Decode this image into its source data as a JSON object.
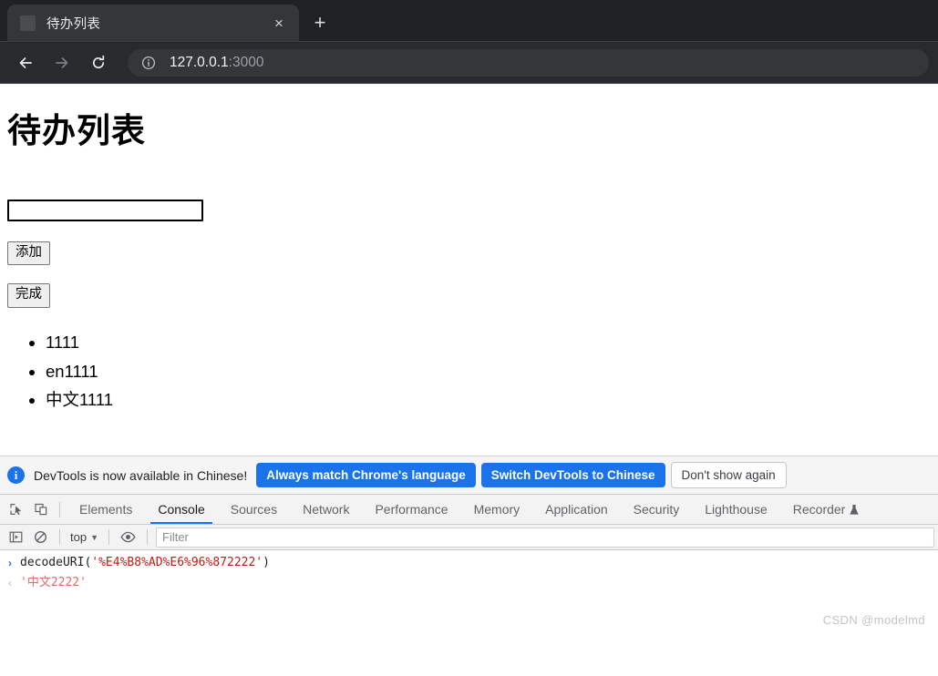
{
  "browser": {
    "tab": {
      "title": "待办列表",
      "favicon": "page-favicon",
      "close_label": "×"
    },
    "new_tab_label": "+",
    "nav": {
      "back": "back-arrow",
      "forward": "forward-arrow",
      "reload": "reload"
    },
    "omnibox": {
      "security_icon": "info-circle-icon",
      "host": "127.0.0.1",
      "port": ":3000"
    }
  },
  "page": {
    "heading": "待办列表",
    "input": {
      "value": "",
      "placeholder": ""
    },
    "buttons": {
      "add": "添加",
      "done": "完成"
    },
    "todos": [
      "1111",
      "en1111",
      "中文1111"
    ]
  },
  "devtools": {
    "infobar": {
      "message": "DevTools is now available in Chinese!",
      "primary_1": "Always match Chrome's language",
      "primary_2": "Switch DevTools to Chinese",
      "secondary": "Don't show again"
    },
    "tabs": [
      {
        "label": "Elements",
        "active": false
      },
      {
        "label": "Console",
        "active": true
      },
      {
        "label": "Sources",
        "active": false
      },
      {
        "label": "Network",
        "active": false
      },
      {
        "label": "Performance",
        "active": false
      },
      {
        "label": "Memory",
        "active": false
      },
      {
        "label": "Application",
        "active": false
      },
      {
        "label": "Security",
        "active": false
      },
      {
        "label": "Lighthouse",
        "active": false
      },
      {
        "label": "Recorder",
        "active": false
      }
    ],
    "console_toolbar": {
      "sidebar_icon": "console-sidebar-icon",
      "clear_icon": "clear-console-icon",
      "context": "top",
      "context_caret": "▼",
      "eye_icon": "live-expression-icon",
      "filter_placeholder": "Filter"
    },
    "console": {
      "input_prompt": "›",
      "output_prompt": "‹",
      "input_fn": "decodeURI(",
      "input_str": "'%E4%B8%AD%E6%96%872222'",
      "input_close": ")",
      "output_value": "'中文2222'"
    }
  },
  "watermark": "CSDN @modelmd",
  "colors": {
    "chrome_bg": "#202124",
    "toolbar_bg": "#292a2d",
    "tab_active": "#35363a",
    "accent": "#1a73e8",
    "string_red": "#c41a16",
    "output_red": "#e06c6c"
  }
}
